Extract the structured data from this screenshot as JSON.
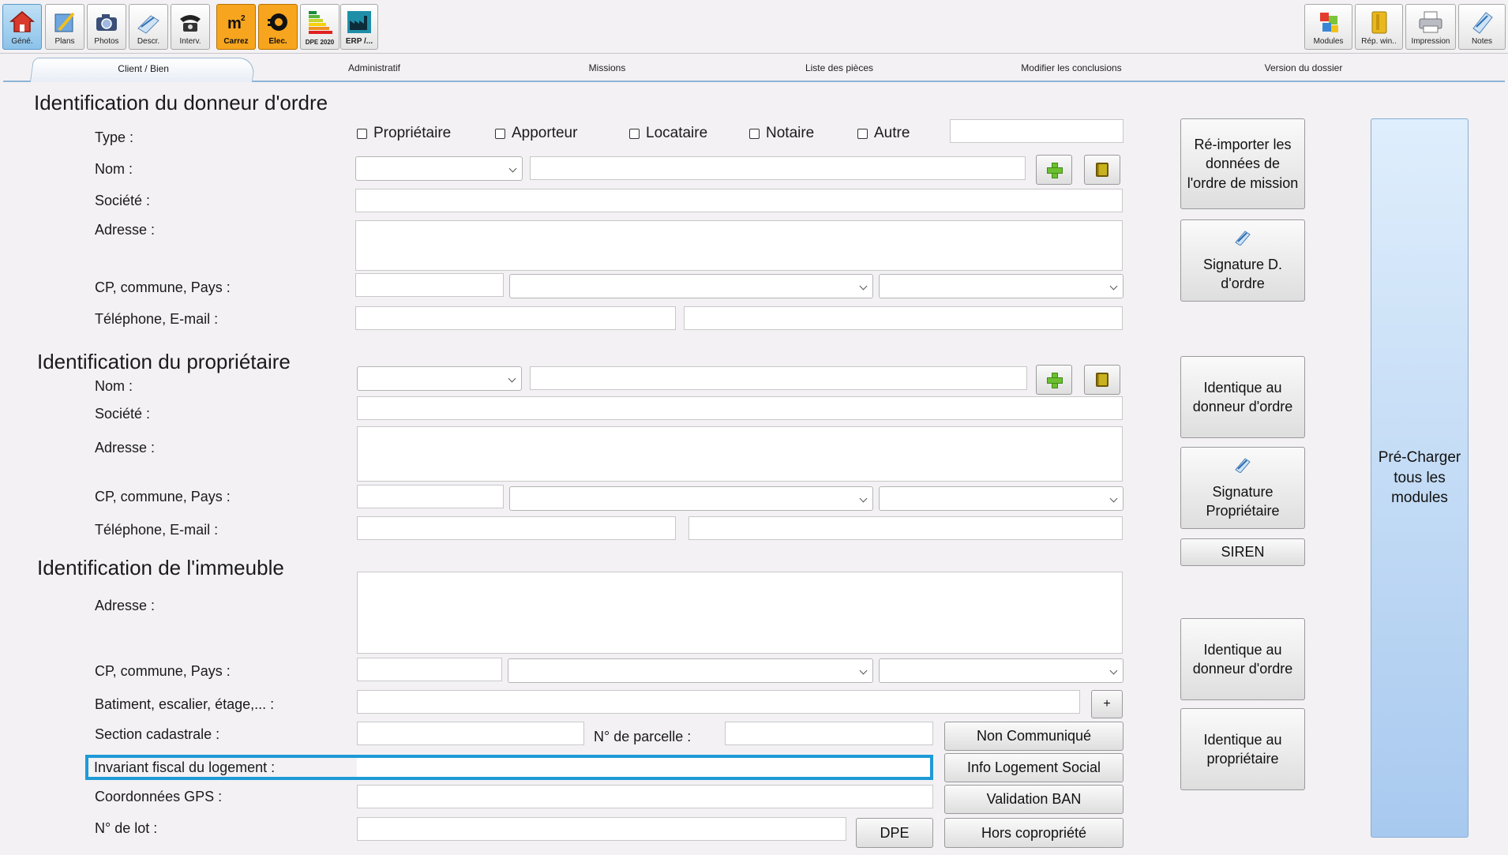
{
  "toolbar": {
    "left": [
      {
        "id": "gene",
        "label": "Géné.",
        "icon": "house-icon"
      },
      {
        "id": "plans",
        "label": "Plans",
        "icon": "pencil-blueprint-icon"
      },
      {
        "id": "photos",
        "label": "Photos",
        "icon": "camera-icon"
      },
      {
        "id": "descr",
        "label": "Descr.",
        "icon": "drawing-tool-icon"
      },
      {
        "id": "interv",
        "label": "Interv.",
        "icon": "telephone-icon"
      },
      {
        "id": "carrez",
        "label": "Carrez",
        "icon": "m2-icon",
        "icon_text": "m²"
      },
      {
        "id": "elec",
        "label": "Élec.",
        "icon": "plug-icon"
      },
      {
        "id": "dpe",
        "label": "DPE 2020",
        "icon": "energy-label-icon"
      },
      {
        "id": "erp",
        "label": "ERP /...",
        "icon": "factory-icon"
      }
    ],
    "right": [
      {
        "id": "modules",
        "label": "Modules",
        "icon": "puzzle-icon"
      },
      {
        "id": "rep",
        "label": "Rép. win..",
        "icon": "folder-icon"
      },
      {
        "id": "impression",
        "label": "Impression",
        "icon": "printer-icon"
      },
      {
        "id": "notes",
        "label": "Notes",
        "icon": "notepad-icon"
      }
    ]
  },
  "tabs": [
    "Client / Bien",
    "Administratif",
    "Missions",
    "Liste des pièces",
    "Modifier les conclusions",
    "Version du dossier"
  ],
  "donneur": {
    "title": "Identification du donneur d'ordre",
    "type_label": "Type :",
    "type_options": [
      "Propriétaire",
      "Apporteur",
      "Locataire",
      "Notaire",
      "Autre"
    ],
    "nom_label": "Nom :",
    "societe_label": "Société :",
    "adresse_label": "Adresse :",
    "cp_label": "CP, commune, Pays :",
    "tel_label": "Téléphone, E-mail :"
  },
  "proprietaire": {
    "title": "Identification du propriétaire",
    "nom_label": "Nom :",
    "societe_label": "Société :",
    "adresse_label": "Adresse :",
    "cp_label": "CP, commune, Pays :",
    "tel_label": "Téléphone, E-mail :"
  },
  "immeuble": {
    "title": "Identification de l'immeuble",
    "adresse_label": "Adresse :",
    "cp_label": "CP, commune, Pays :",
    "batiment_label": "Batiment, escalier, étage,... :",
    "batiment_add": "+",
    "section_label": "Section cadastrale :",
    "parcelle_label": "N° de parcelle :",
    "invariant_label": "Invariant fiscal du logement :",
    "gps_label": "Coordonnées GPS :",
    "lot_label": "N° de lot :",
    "dpe_button": "DPE",
    "non_communique": "Non Communiqué",
    "info_logement": "Info Logement Social",
    "validation_ban": "Validation BAN",
    "hors_copro": "Hors copropriété"
  },
  "side_buttons": {
    "reimport": "Ré-importer les données de l'ordre de mission",
    "signature_do": "Signature D. d'ordre",
    "identique_do_1": "Identique au donneur d'ordre",
    "signature_prop": "Signature Propriétaire",
    "siren": "SIREN",
    "identique_do_2": "Identique au donneur d'ordre",
    "identique_prop": "Identique au propriétaire",
    "precharger": "Pré-Charger tous les modules"
  }
}
